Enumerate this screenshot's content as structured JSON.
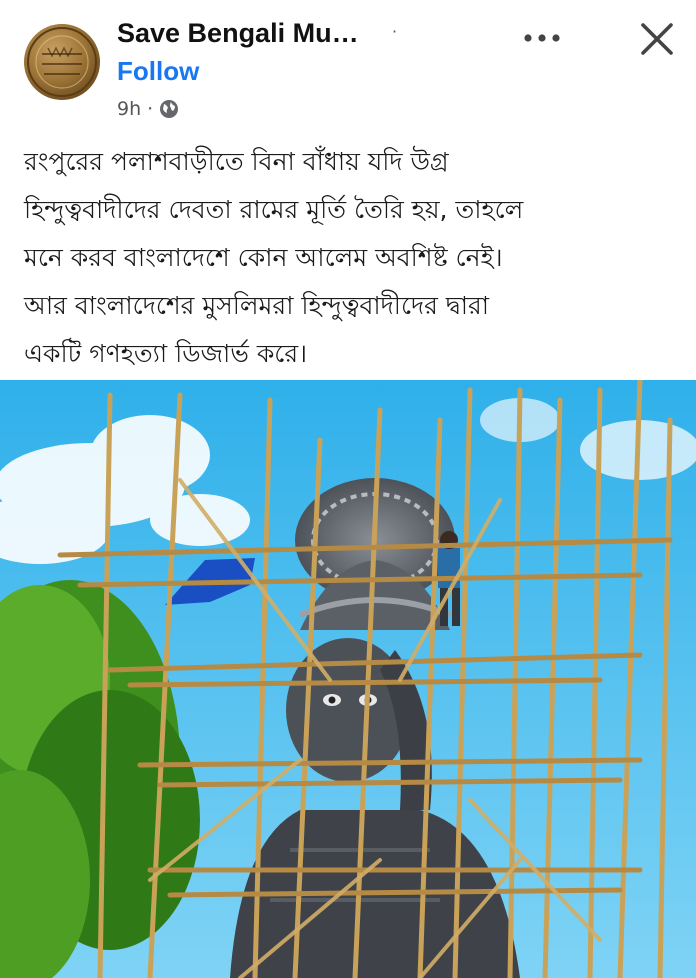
{
  "post": {
    "page_name": "Save Bengali Mu…",
    "separator": "·",
    "follow_label": "Follow",
    "time": "9h",
    "time_separator": "·",
    "privacy_icon": "globe-icon",
    "more_icon": "more-dots-icon",
    "close_icon": "close-icon",
    "text_lines": [
      "রংপুরের পলাশবাড়ীতে বিনা বাঁধায় যদি উগ্র",
      "হিন্দুত্ববাদীদের দেবতা রামের মূর্তি তৈরি হয়, তাহলে",
      "মনে করব বাংলাদেশে কোন আলেম অবশিষ্ট নেই।",
      "আর বাংলাদেশের মুসলিমরা হিন্দুত্ববাদীদের দ্বারা",
      "একটি গণহত্যা ডিজার্ভ করে।"
    ]
  },
  "colors": {
    "follow": "#1877f2",
    "sky": "#3cb8ee",
    "statue": "#4a4e55",
    "bamboo": "#c9a25a"
  }
}
